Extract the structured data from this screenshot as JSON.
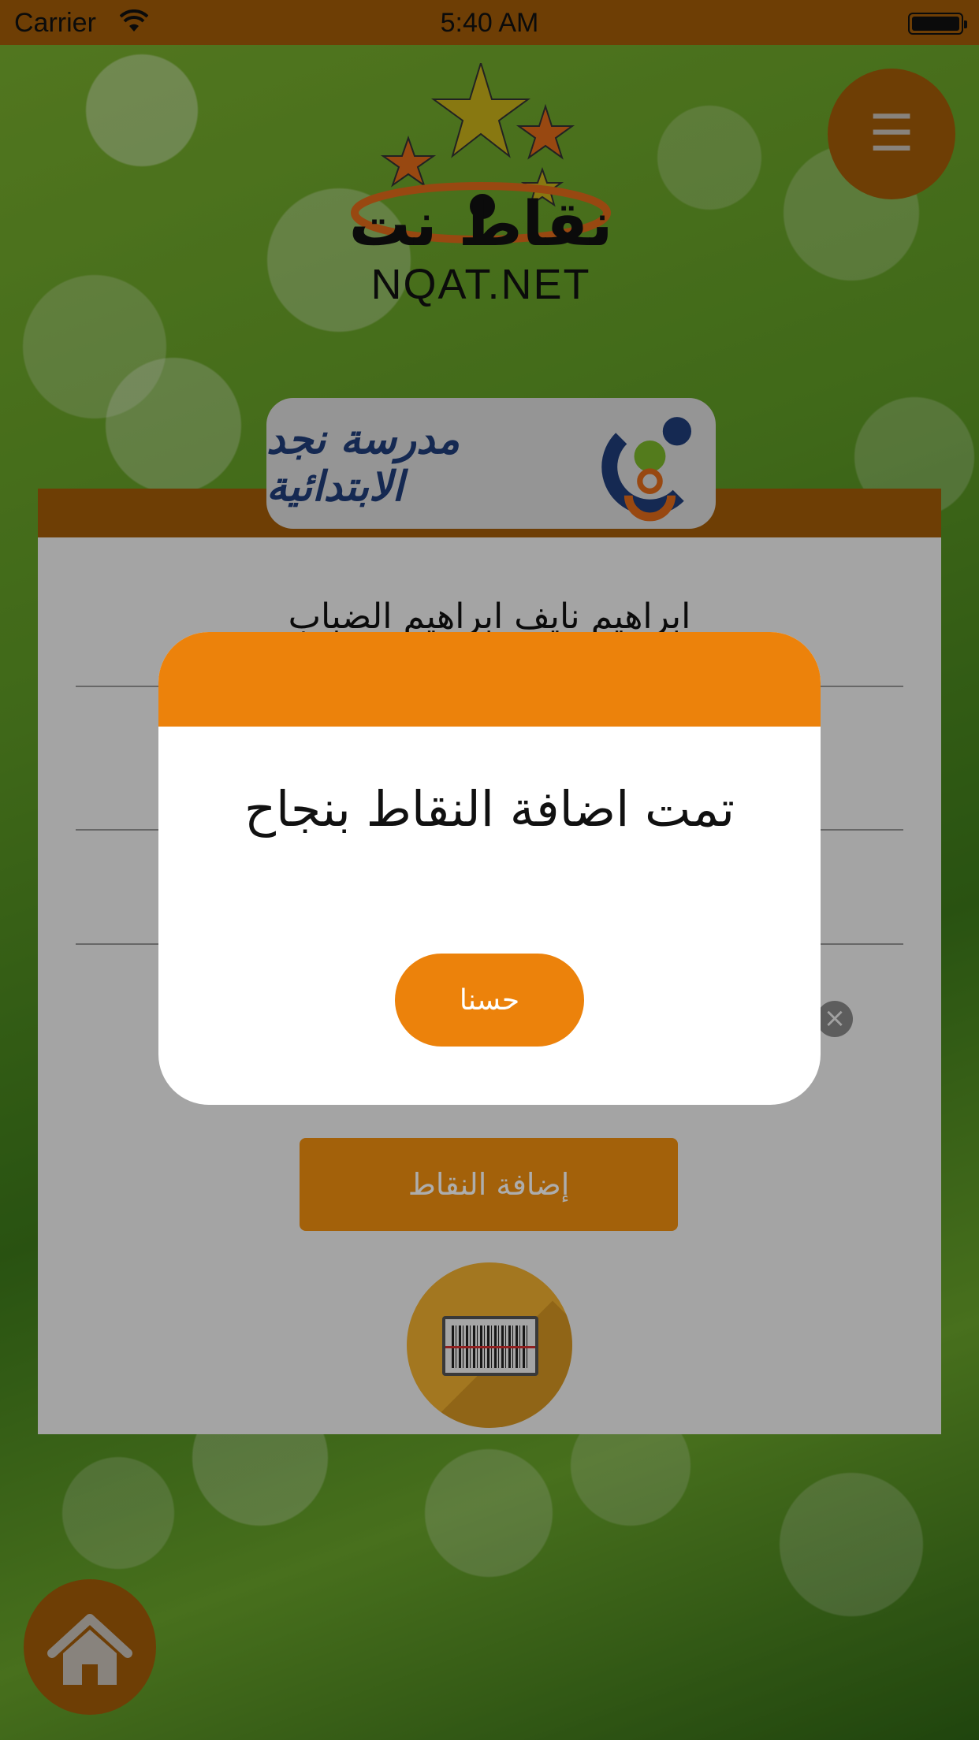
{
  "status_bar": {
    "carrier": "Carrier",
    "time": "5:40 AM"
  },
  "header": {
    "logo_text": "NQAT.NET",
    "logo_arabic": "نقاط نت",
    "menu_icon": "☰"
  },
  "school": {
    "name": "مدرسة نجد الابتدائية"
  },
  "form": {
    "student_name": "ابراهيم نايف ابراهيم الضباب",
    "clear_icon": "×",
    "add_points_label": "إضافة النقاط"
  },
  "dialog": {
    "message": "تمت اضافة النقاط بنجاح",
    "ok_label": "حسنا"
  },
  "colors": {
    "brand_orange": "#a35c08",
    "dialog_orange": "#ec820b"
  }
}
